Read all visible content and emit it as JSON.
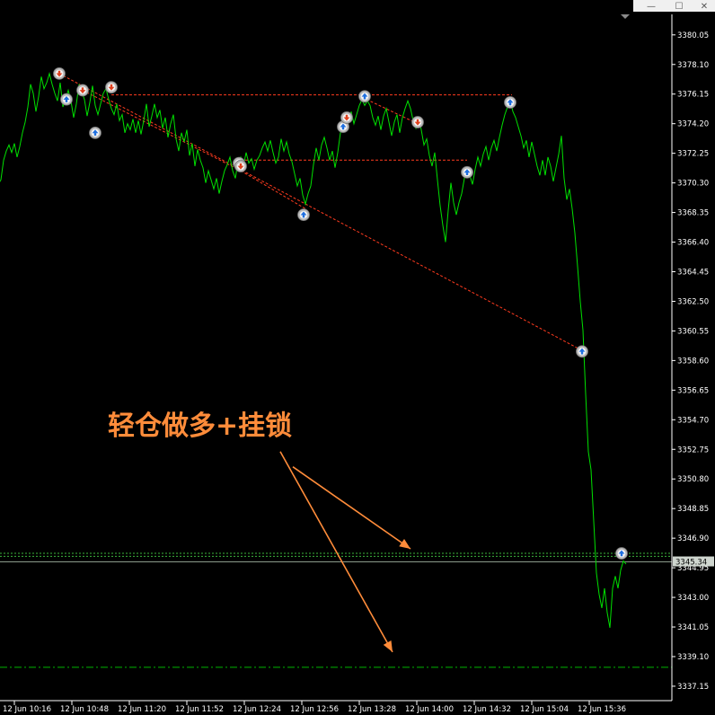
{
  "window": {
    "controls": [
      "—",
      "☐",
      "✕"
    ]
  },
  "chart_data": {
    "type": "line",
    "symbol_series": "price",
    "colors": {
      "background": "#000000",
      "price_line": "#00e000",
      "dotted_level": "#3cb43c",
      "dashdot_level": "#00b400",
      "current_price_line": "#8a9a8a",
      "trade_line": "#ff3b1f",
      "annotation": "#ff8c3a",
      "axis": "#ffffff",
      "buy_marker": "#1e6fe0",
      "sell_marker": "#e0401e",
      "marker_ring": "#b8b8b8"
    },
    "ylim": [
      3336.2,
      3381.4
    ],
    "y_ticks": [
      "3380.05",
      "3378.10",
      "3376.15",
      "3374.20",
      "3372.25",
      "3370.30",
      "3368.35",
      "3366.40",
      "3364.45",
      "3362.50",
      "3360.55",
      "3358.60",
      "3356.65",
      "3354.70",
      "3352.75",
      "3350.80",
      "3348.85",
      "3346.90",
      "3344.95",
      "3343.00",
      "3341.05",
      "3339.10",
      "3337.15"
    ],
    "x_ticks": [
      "12 Jun 10:16",
      "12 Jun 10:48",
      "12 Jun 11:20",
      "12 Jun 11:52",
      "12 Jun 12:24",
      "12 Jun 12:56",
      "12 Jun 13:28",
      "12 Jun 14:00",
      "12 Jun 14:32",
      "12 Jun 15:04",
      "12 Jun 15:36"
    ],
    "current_price_label": "3345.34",
    "current_price": 3345.34,
    "levels": [
      {
        "style": "dotted",
        "y": 3345.9
      },
      {
        "style": "dotted",
        "y": 3345.7
      },
      {
        "style": "dashdot",
        "y": 3338.4
      }
    ],
    "price": [
      [
        -2,
        3370.2
      ],
      [
        1,
        3370.5
      ],
      [
        4,
        3371.8
      ],
      [
        7,
        3372.4
      ],
      [
        10,
        3372.8
      ],
      [
        13,
        3372.3
      ],
      [
        16,
        3372.9
      ],
      [
        19,
        3372.0
      ],
      [
        22,
        3372.7
      ],
      [
        25,
        3373.6
      ],
      [
        28,
        3374.3
      ],
      [
        31,
        3375.3
      ],
      [
        34,
        3376.8
      ],
      [
        37,
        3376.2
      ],
      [
        40,
        3375.0
      ],
      [
        43,
        3376.0
      ],
      [
        46,
        3377.3
      ],
      [
        49,
        3376.5
      ],
      [
        52,
        3376.9
      ],
      [
        55,
        3377.5
      ],
      [
        58,
        3376.8
      ],
      [
        61,
        3376.2
      ],
      [
        64,
        3375.7
      ],
      [
        67,
        3376.9
      ],
      [
        70,
        3375.3
      ],
      [
        73,
        3375.8
      ],
      [
        76,
        3376.4
      ],
      [
        79,
        3375.7
      ],
      [
        82,
        3374.6
      ],
      [
        85,
        3375.5
      ],
      [
        88,
        3376.8
      ],
      [
        91,
        3376.3
      ],
      [
        94,
        3375.8
      ],
      [
        97,
        3374.7
      ],
      [
        100,
        3375.6
      ],
      [
        103,
        3376.7
      ],
      [
        106,
        3375.4
      ],
      [
        109,
        3374.8
      ],
      [
        112,
        3375.5
      ],
      [
        115,
        3376.2
      ],
      [
        118,
        3376.5
      ],
      [
        121,
        3375.8
      ],
      [
        124,
        3375.2
      ],
      [
        127,
        3374.8
      ],
      [
        130,
        3375.5
      ],
      [
        133,
        3374.4
      ],
      [
        136,
        3374.8
      ],
      [
        139,
        3373.6
      ],
      [
        142,
        3374.2
      ],
      [
        145,
        3373.8
      ],
      [
        148,
        3374.5
      ],
      [
        151,
        3373.6
      ],
      [
        154,
        3374.4
      ],
      [
        157,
        3373.5
      ],
      [
        160,
        3374.4
      ],
      [
        163,
        3375.5
      ],
      [
        166,
        3374.0
      ],
      [
        169,
        3374.7
      ],
      [
        172,
        3375.5
      ],
      [
        175,
        3374.6
      ],
      [
        178,
        3375.1
      ],
      [
        181,
        3373.9
      ],
      [
        184,
        3374.6
      ],
      [
        187,
        3373.3
      ],
      [
        190,
        3374.2
      ],
      [
        193,
        3374.8
      ],
      [
        196,
        3373.2
      ],
      [
        199,
        3372.4
      ],
      [
        202,
        3373.6
      ],
      [
        205,
        3373.0
      ],
      [
        208,
        3373.8
      ],
      [
        211,
        3372.1
      ],
      [
        214,
        3372.9
      ],
      [
        217,
        3371.4
      ],
      [
        220,
        3372.5
      ],
      [
        223,
        3371.8
      ],
      [
        226,
        3371.3
      ],
      [
        229,
        3370.3
      ],
      [
        232,
        3371.1
      ],
      [
        235,
        3370.5
      ],
      [
        238,
        3369.9
      ],
      [
        241,
        3370.6
      ],
      [
        244,
        3369.6
      ],
      [
        247,
        3370.4
      ],
      [
        250,
        3371.1
      ],
      [
        253,
        3371.5
      ],
      [
        256,
        3372.0
      ],
      [
        259,
        3371.1
      ],
      [
        262,
        3370.6
      ],
      [
        265,
        3371.7
      ],
      [
        268,
        3372.0
      ],
      [
        271,
        3371.4
      ],
      [
        274,
        3372.3
      ],
      [
        277,
        3371.6
      ],
      [
        280,
        3371.9
      ],
      [
        283,
        3371.2
      ],
      [
        286,
        3371.8
      ],
      [
        289,
        3372.1
      ],
      [
        292,
        3372.6
      ],
      [
        295,
        3373.0
      ],
      [
        298,
        3372.4
      ],
      [
        301,
        3373.1
      ],
      [
        304,
        3372.3
      ],
      [
        307,
        3371.6
      ],
      [
        310,
        3372.0
      ],
      [
        313,
        3373.2
      ],
      [
        316,
        3372.4
      ],
      [
        319,
        3373.0
      ],
      [
        322,
        3372.2
      ],
      [
        325,
        3371.7
      ],
      [
        328,
        3370.9
      ],
      [
        331,
        3370.1
      ],
      [
        334,
        3370.6
      ],
      [
        337,
        3369.5
      ],
      [
        340,
        3368.9
      ],
      [
        343,
        3369.6
      ],
      [
        346,
        3370.1
      ],
      [
        349,
        3371.5
      ],
      [
        352,
        3372.6
      ],
      [
        355,
        3371.8
      ],
      [
        358,
        3372.8
      ],
      [
        361,
        3373.3
      ],
      [
        364,
        3372.6
      ],
      [
        367,
        3371.8
      ],
      [
        370,
        3372.4
      ],
      [
        373,
        3371.3
      ],
      [
        376,
        3372.3
      ],
      [
        379,
        3373.6
      ],
      [
        382,
        3374.1
      ],
      [
        385,
        3374.6
      ],
      [
        388,
        3374.3
      ],
      [
        391,
        3375.0
      ],
      [
        394,
        3374.2
      ],
      [
        397,
        3374.8
      ],
      [
        400,
        3375.4
      ],
      [
        403,
        3375.8
      ],
      [
        406,
        3375.4
      ],
      [
        409,
        3375.7
      ],
      [
        412,
        3375.4
      ],
      [
        415,
        3374.6
      ],
      [
        418,
        3374.1
      ],
      [
        421,
        3374.7
      ],
      [
        424,
        3373.8
      ],
      [
        427,
        3374.7
      ],
      [
        430,
        3375.2
      ],
      [
        433,
        3374.3
      ],
      [
        436,
        3373.4
      ],
      [
        439,
        3374.3
      ],
      [
        442,
        3374.8
      ],
      [
        445,
        3373.6
      ],
      [
        448,
        3374.6
      ],
      [
        451,
        3375.2
      ],
      [
        454,
        3375.7
      ],
      [
        457,
        3375.2
      ],
      [
        460,
        3374.4
      ],
      [
        463,
        3373.9
      ],
      [
        466,
        3374.6
      ],
      [
        469,
        3373.8
      ],
      [
        472,
        3372.8
      ],
      [
        475,
        3373.2
      ],
      [
        478,
        3372.1
      ],
      [
        481,
        3371.4
      ],
      [
        484,
        3372.3
      ],
      [
        487,
        3370.5
      ],
      [
        490,
        3368.8
      ],
      [
        493,
        3367.5
      ],
      [
        496,
        3366.4
      ],
      [
        499,
        3368.5
      ],
      [
        502,
        3370.3
      ],
      [
        505,
        3369.0
      ],
      [
        508,
        3368.2
      ],
      [
        511,
        3369.0
      ],
      [
        514,
        3369.6
      ],
      [
        517,
        3370.6
      ],
      [
        520,
        3371.2
      ],
      [
        523,
        3370.8
      ],
      [
        526,
        3370.2
      ],
      [
        529,
        3371.2
      ],
      [
        532,
        3372.0
      ],
      [
        535,
        3371.4
      ],
      [
        538,
        3372.2
      ],
      [
        541,
        3372.7
      ],
      [
        544,
        3371.8
      ],
      [
        547,
        3372.6
      ],
      [
        550,
        3373.1
      ],
      [
        553,
        3372.4
      ],
      [
        556,
        3373.3
      ],
      [
        559,
        3374.1
      ],
      [
        562,
        3374.8
      ],
      [
        565,
        3375.3
      ],
      [
        568,
        3375.7
      ],
      [
        571,
        3375.0
      ],
      [
        574,
        3374.6
      ],
      [
        577,
        3374.0
      ],
      [
        580,
        3373.4
      ],
      [
        583,
        3372.6
      ],
      [
        586,
        3373.1
      ],
      [
        589,
        3372.0
      ],
      [
        592,
        3373.0
      ],
      [
        595,
        3372.2
      ],
      [
        598,
        3371.4
      ],
      [
        601,
        3370.8
      ],
      [
        604,
        3371.8
      ],
      [
        607,
        3370.8
      ],
      [
        610,
        3372.0
      ],
      [
        613,
        3371.4
      ],
      [
        616,
        3370.4
      ],
      [
        619,
        3371.3
      ],
      [
        622,
        3372.2
      ],
      [
        625,
        3373.4
      ],
      [
        628,
        3370.6
      ],
      [
        631,
        3369.2
      ],
      [
        634,
        3369.9
      ],
      [
        637,
        3368.6
      ],
      [
        640,
        3367.0
      ],
      [
        643,
        3364.8
      ],
      [
        646,
        3362.5
      ],
      [
        649,
        3360.6
      ],
      [
        652,
        3356.4
      ],
      [
        655,
        3352.6
      ],
      [
        658,
        3351.4
      ],
      [
        661,
        3348.0
      ],
      [
        664,
        3344.6
      ],
      [
        667,
        3343.2
      ],
      [
        670,
        3342.3
      ],
      [
        673,
        3343.6
      ],
      [
        676,
        3342.0
      ],
      [
        679,
        3341.0
      ],
      [
        682,
        3343.6
      ],
      [
        685,
        3344.4
      ],
      [
        688,
        3343.6
      ],
      [
        691,
        3344.8
      ],
      [
        694,
        3345.4
      ],
      [
        697,
        3345.2
      ]
    ],
    "trade_lines": [
      {
        "from": [
          66,
          3377.5
        ],
        "to": [
          650,
          3359.2
        ]
      },
      {
        "from": [
          92,
          3376.4
        ],
        "to": [
          268,
          3371.1
        ]
      },
      {
        "from": [
          268,
          3371.1
        ],
        "to": [
          340,
          3368.6
        ]
      },
      {
        "from": [
          124,
          3376.1
        ],
        "to": [
          570,
          3376.1
        ]
      },
      {
        "from": [
          268,
          3371.8
        ],
        "to": [
          520,
          3371.8
        ]
      },
      {
        "from": [
          408,
          3375.8
        ],
        "to": [
          465,
          3374.2
        ]
      }
    ],
    "markers": [
      {
        "x": 66,
        "y": 3377.5,
        "side": "sell"
      },
      {
        "x": 74,
        "y": 3375.8,
        "side": "buy"
      },
      {
        "x": 92,
        "y": 3376.4,
        "side": "sell"
      },
      {
        "x": 106,
        "y": 3373.6,
        "side": "buy"
      },
      {
        "x": 124,
        "y": 3376.6,
        "side": "sell"
      },
      {
        "x": 266,
        "y": 3371.6,
        "side": "buy"
      },
      {
        "x": 268,
        "y": 3371.4,
        "side": "sell"
      },
      {
        "x": 338,
        "y": 3368.2,
        "side": "buy"
      },
      {
        "x": 382,
        "y": 3374.0,
        "side": "buy"
      },
      {
        "x": 386,
        "y": 3374.6,
        "side": "sell"
      },
      {
        "x": 406,
        "y": 3376.0,
        "side": "buy"
      },
      {
        "x": 465,
        "y": 3374.3,
        "side": "sell"
      },
      {
        "x": 520,
        "y": 3371.0,
        "side": "buy"
      },
      {
        "x": 568,
        "y": 3375.6,
        "side": "buy"
      },
      {
        "x": 648,
        "y": 3359.2,
        "side": "buy"
      },
      {
        "x": 692,
        "y": 3345.9,
        "side": "buy"
      }
    ],
    "annotation": {
      "text": "轻仓做多+挂锁"
    },
    "arrows": [
      {
        "from": [
          326,
          3351.6
        ],
        "to": [
          457,
          3346.2
        ]
      },
      {
        "from": [
          312,
          3352.6
        ],
        "to": [
          437,
          3339.4
        ]
      }
    ]
  }
}
